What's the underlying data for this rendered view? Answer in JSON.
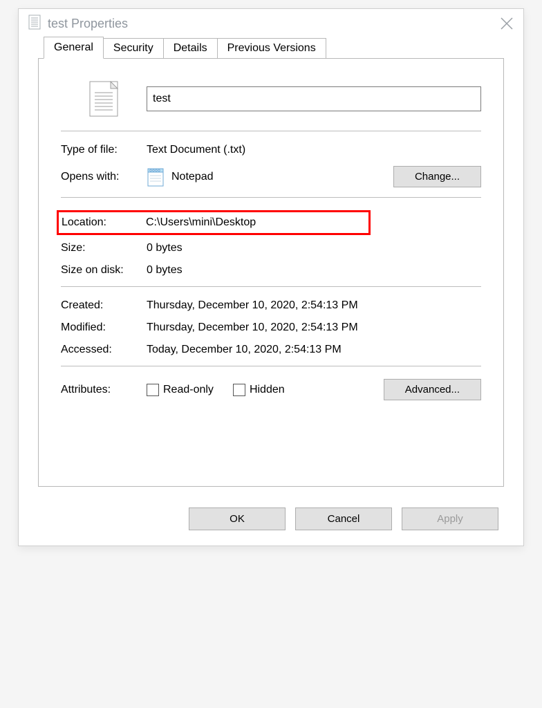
{
  "window": {
    "title": "test Properties"
  },
  "tabs": {
    "general": "General",
    "security": "Security",
    "details": "Details",
    "previous": "Previous Versions"
  },
  "filename": "test",
  "labels": {
    "type": "Type of file:",
    "opens": "Opens with:",
    "location": "Location:",
    "size": "Size:",
    "ondisk": "Size on disk:",
    "created": "Created:",
    "modified": "Modified:",
    "accessed": "Accessed:",
    "attributes": "Attributes:"
  },
  "values": {
    "type": "Text Document (.txt)",
    "opens": "Notepad",
    "location": "C:\\Users\\mini\\Desktop",
    "size": "0 bytes",
    "ondisk": "0 bytes",
    "created": "Thursday, December 10, 2020, 2:54:13 PM",
    "modified": "Thursday, December 10, 2020, 2:54:13 PM",
    "accessed": "Today, December 10, 2020, 2:54:13 PM"
  },
  "attr": {
    "readonly": "Read-only",
    "hidden": "Hidden"
  },
  "buttons": {
    "change": "Change...",
    "advanced": "Advanced...",
    "ok": "OK",
    "cancel": "Cancel",
    "apply": "Apply"
  }
}
